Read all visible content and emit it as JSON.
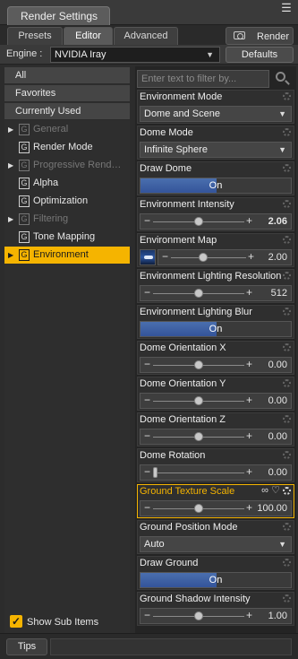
{
  "window": {
    "title": "Render Settings"
  },
  "tabs": [
    {
      "label": "Presets"
    },
    {
      "label": "Editor"
    },
    {
      "label": "Advanced"
    }
  ],
  "toolbar": {
    "render_label": "Render"
  },
  "engine": {
    "label": "Engine :",
    "value": "NVIDIA Iray",
    "defaults_label": "Defaults"
  },
  "sidebar": {
    "items": [
      {
        "label": "All"
      },
      {
        "label": "Favorites"
      },
      {
        "label": "Currently Used"
      },
      {
        "label": "General"
      },
      {
        "label": "Render Mode"
      },
      {
        "label": "Progressive Rend…"
      },
      {
        "label": "Alpha"
      },
      {
        "label": "Optimization"
      },
      {
        "label": "Filtering"
      },
      {
        "label": "Tone Mapping"
      },
      {
        "label": "Environment"
      }
    ],
    "group_icon": "G",
    "show_sub_items": "Show Sub Items"
  },
  "filter": {
    "placeholder": "Enter text to filter by..."
  },
  "properties": [
    {
      "label": "Environment Mode",
      "value": "Dome and Scene"
    },
    {
      "label": "Dome Mode",
      "value": "Infinite Sphere"
    },
    {
      "label": "Draw Dome",
      "value": "On"
    },
    {
      "label": "Environment Intensity",
      "value": "2.06"
    },
    {
      "label": "Environment Map",
      "value": "2.00"
    },
    {
      "label": "Environment Lighting Resolution",
      "value": "512"
    },
    {
      "label": "Environment Lighting Blur",
      "value": "On"
    },
    {
      "label": "Dome Orientation X",
      "value": "0.00"
    },
    {
      "label": "Dome Orientation Y",
      "value": "0.00"
    },
    {
      "label": "Dome Orientation Z",
      "value": "0.00"
    },
    {
      "label": "Dome Rotation",
      "value": "0.00"
    },
    {
      "label": "Ground Texture Scale",
      "value": "100.00"
    },
    {
      "label": "Ground Position Mode",
      "value": "Auto"
    },
    {
      "label": "Draw Ground",
      "value": "On"
    },
    {
      "label": "Ground Shadow Intensity",
      "value": "1.00"
    }
  ],
  "status": {
    "tips_label": "Tips"
  },
  "colors": {
    "accent": "#f5b400",
    "toggle_on": "#3f62a6"
  }
}
